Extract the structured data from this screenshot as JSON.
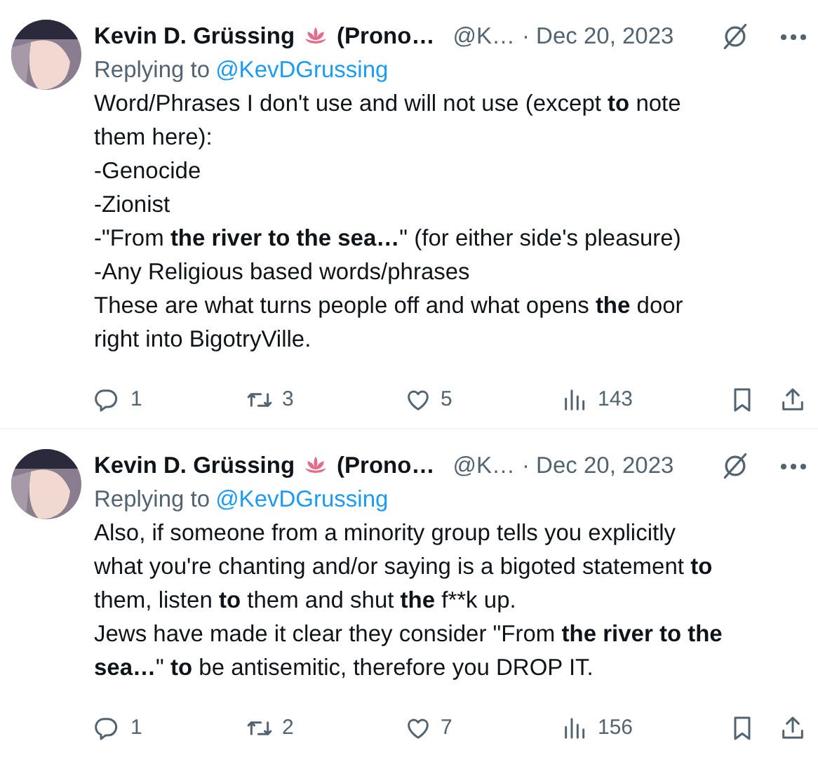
{
  "tweets": [
    {
      "name": "Kevin D. Grüssing",
      "name_rest": "(Prono…",
      "handle": "@K…",
      "date": "· Dec 20, 2023",
      "replying_label": "Replying to",
      "replying_to": "@KevDGrussing",
      "lines": [
        "Word/Phrases I don't use and will not use (except **to** note",
        "them here):",
        "-Genocide",
        "-Zionist",
        "-\"From **the river to the sea…**\" (for either side's pleasure)",
        "-Any Religious based words/phrases",
        "These are what turns people off and what opens **the** door",
        "right into BigotryVille."
      ],
      "replies": "1",
      "reposts": "3",
      "likes": "5",
      "views": "143"
    },
    {
      "name": "Kevin D. Grüssing",
      "name_rest": "(Prono…",
      "handle": "@K…",
      "date": "· Dec 20, 2023",
      "replying_label": "Replying to",
      "replying_to": "@KevDGrussing",
      "lines": [
        "Also, if someone from a minority group tells you explicitly",
        "what you're chanting and/or saying is a bigoted statement **to**",
        "them, listen **to** them and shut **the** f**k up.",
        "Jews have made it clear they consider \"From **the river to the**",
        "**sea…**\" **to** be antisemitic, therefore you DROP IT."
      ],
      "replies": "1",
      "reposts": "2",
      "likes": "7",
      "views": "156"
    }
  ]
}
